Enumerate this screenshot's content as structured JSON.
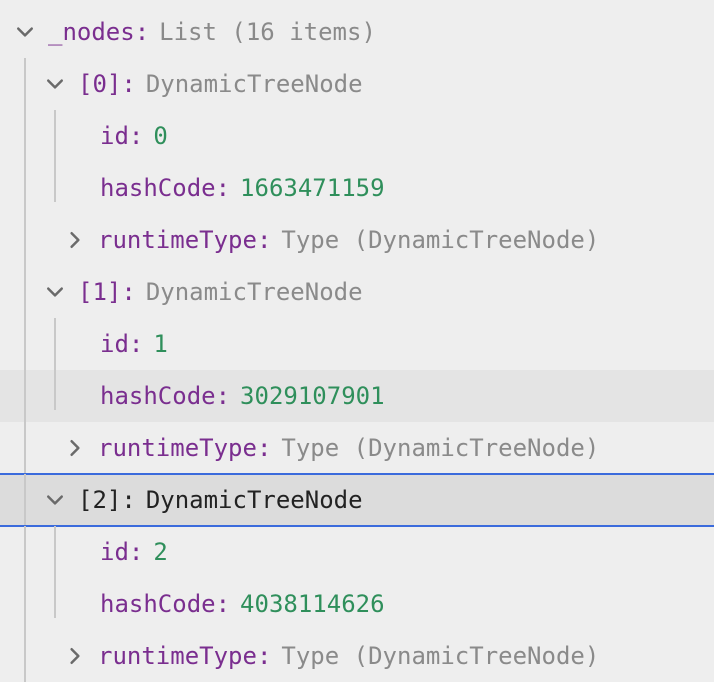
{
  "root": {
    "key": "_nodes",
    "type_label": "List (16 items)"
  },
  "items": [
    {
      "index_label": "[0]",
      "type_label": "DynamicTreeNode",
      "id_key": "id",
      "id_val": "0",
      "hash_key": "hashCode",
      "hash_val": "1663471159",
      "rt_key": "runtimeType",
      "rt_val": "Type (DynamicTreeNode)"
    },
    {
      "index_label": "[1]",
      "type_label": "DynamicTreeNode",
      "id_key": "id",
      "id_val": "1",
      "hash_key": "hashCode",
      "hash_val": "3029107901",
      "rt_key": "runtimeType",
      "rt_val": "Type (DynamicTreeNode)"
    },
    {
      "index_label": "[2]",
      "type_label": "DynamicTreeNode",
      "id_key": "id",
      "id_val": "2",
      "hash_key": "hashCode",
      "hash_val": "4038114626",
      "rt_key": "runtimeType",
      "rt_val": "Type (DynamicTreeNode)"
    }
  ]
}
